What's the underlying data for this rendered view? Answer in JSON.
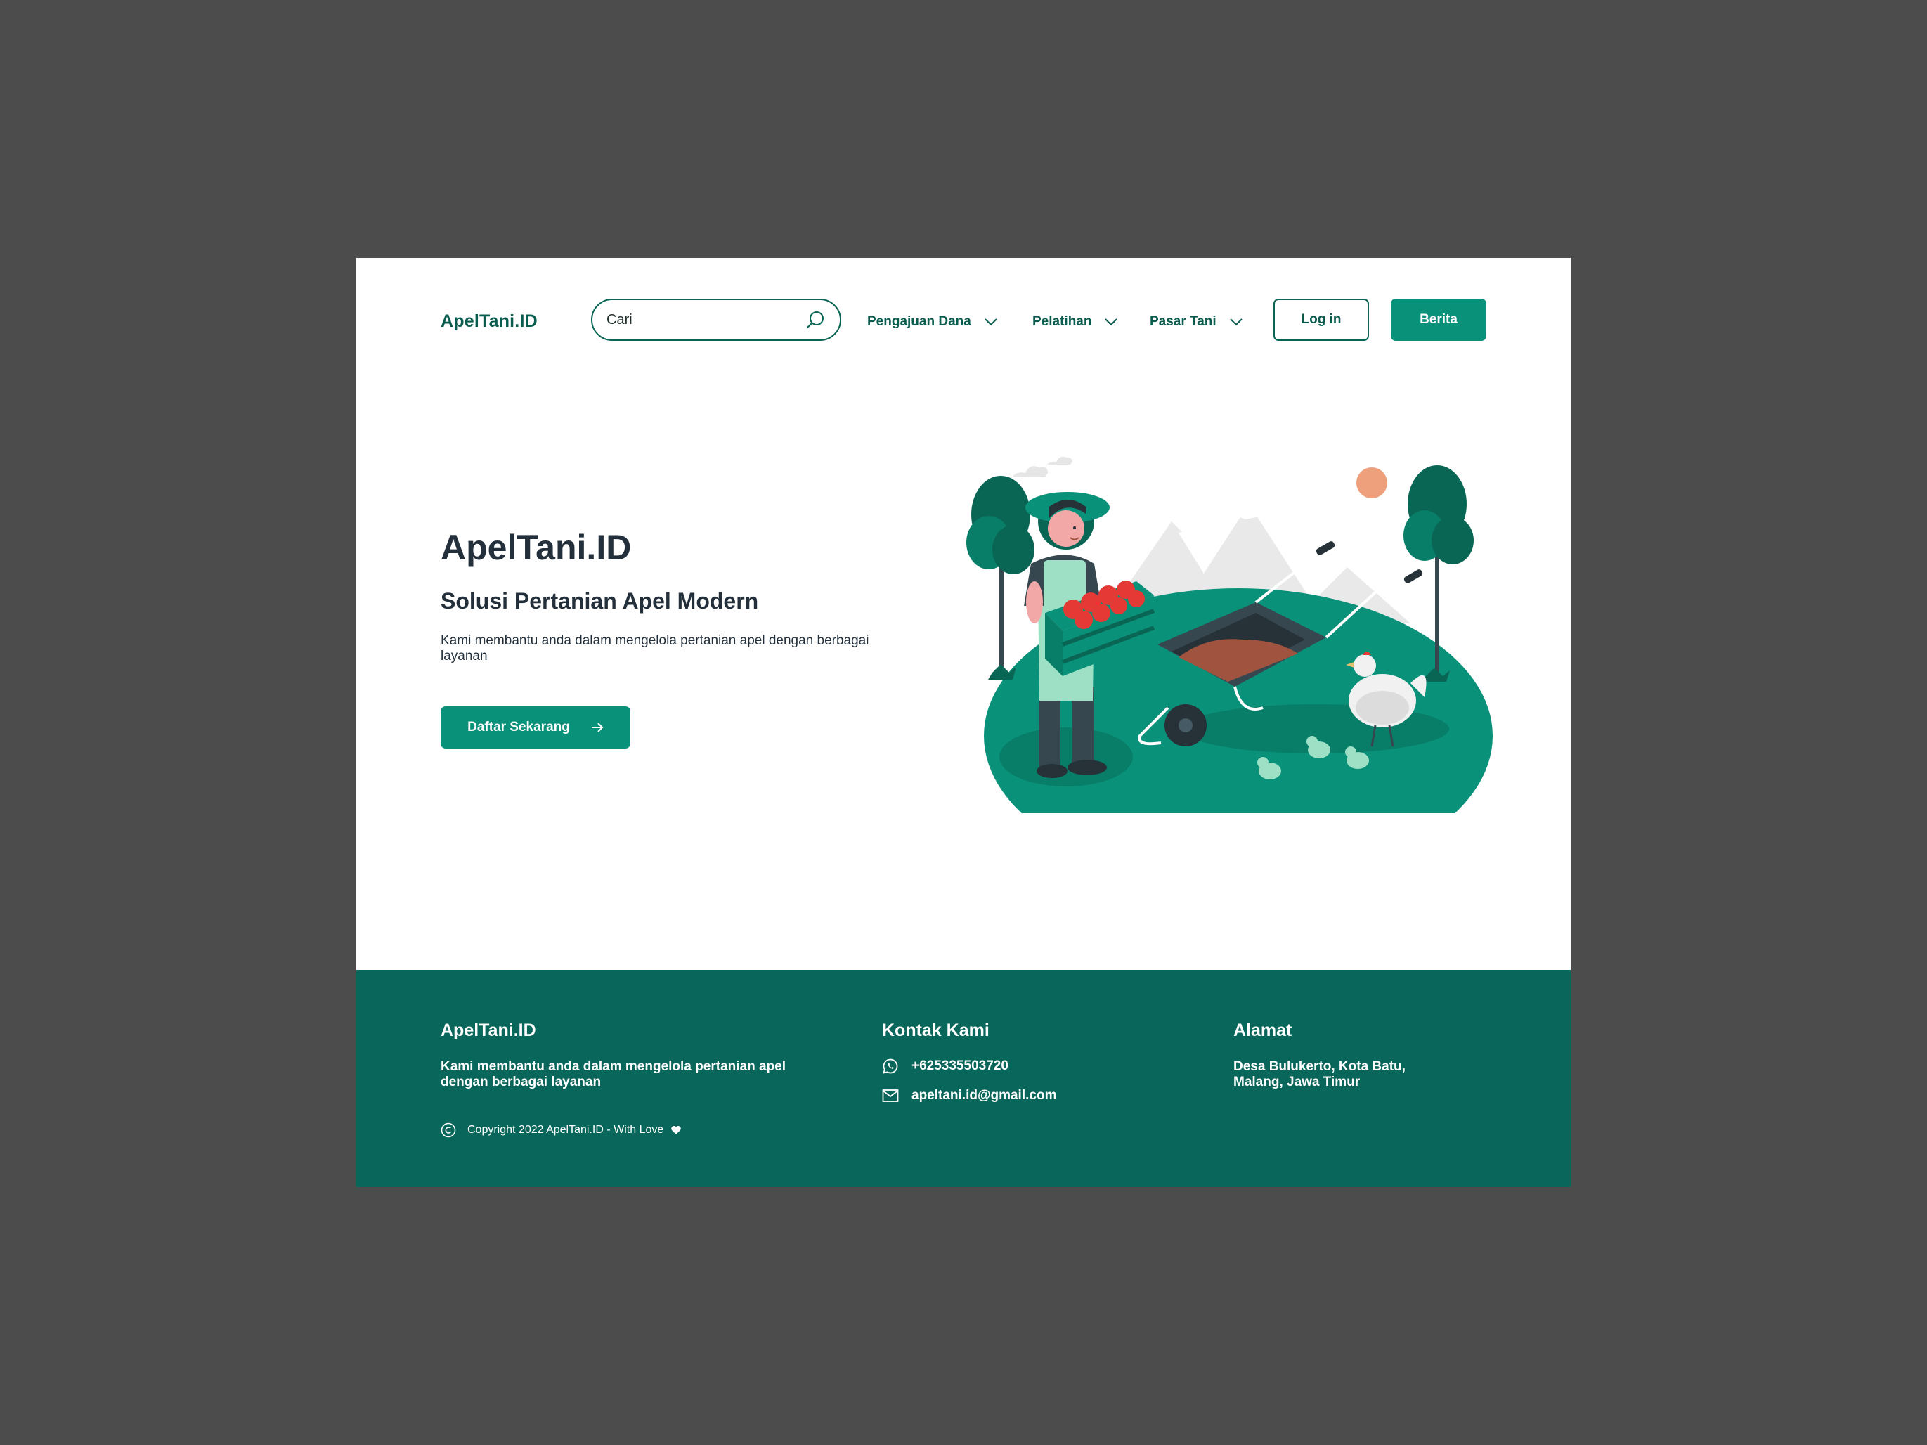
{
  "header": {
    "logo": "ApelTani.ID",
    "search_placeholder": "Cari",
    "nav": [
      {
        "label": "Pengajuan Dana"
      },
      {
        "label": "Pelatihan"
      },
      {
        "label": "Pasar Tani"
      }
    ],
    "login_label": "Log in",
    "berita_label": "Berita"
  },
  "hero": {
    "title": "ApelTani.ID",
    "subtitle": "Solusi Pertanian Apel Modern",
    "description": "Kami membantu anda dalam mengelola pertanian apel dengan berbagai layanan",
    "cta_label": "Daftar Sekarang"
  },
  "footer": {
    "brand": {
      "title": "ApelTani.ID",
      "description": "Kami membantu anda dalam mengelola pertanian apel dengan berbagai layanan",
      "copyright": "Copyright 2022 ApelTani.ID - With Love"
    },
    "contact": {
      "title": "Kontak Kami",
      "phone": "+625335503720",
      "email": "apeltani.id@gmail.com"
    },
    "address": {
      "title": "Alamat",
      "text": "Desa Bulukerto, Kota Batu, Malang, Jawa Timur"
    }
  },
  "colors": {
    "brand_dark": "#0a5c4e",
    "brand_primary": "#0a917a",
    "footer_bg": "#09665a",
    "text_dark": "#23303b",
    "backdrop": "#4c4c4c"
  },
  "icons": [
    "search-icon",
    "chevron-down-icon",
    "arrow-right-icon",
    "whatsapp-icon",
    "mail-icon",
    "copyright-icon",
    "heart-icon"
  ]
}
